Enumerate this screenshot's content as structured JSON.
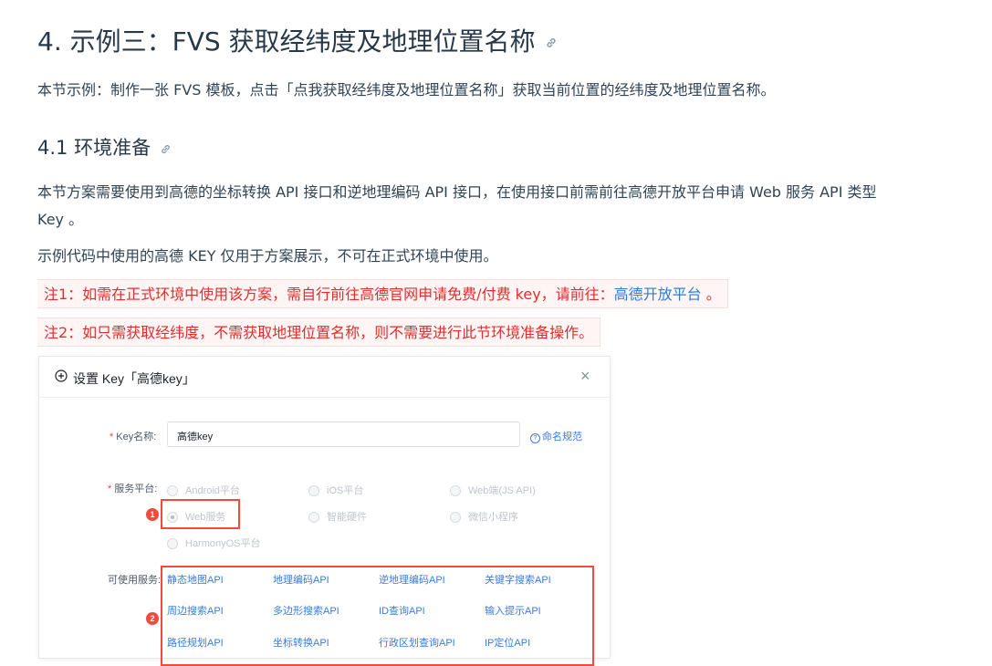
{
  "section": {
    "title": "4. 示例三：FVS 获取经纬度及地理位置名称",
    "intro": "本节示例：制作一张 FVS 模板，点击「点我获取经纬度及地理位置名称」获取当前位置的经纬度及地理位置名称。"
  },
  "subsection": {
    "title": "4.1 环境准备",
    "para1_line1": "本节方案需要使用到高德的坐标转换 API 接口和逆地理编码 API 接口，在使用接口前需前往高德开放平台申请 Web 服务 API 类型",
    "para1_line2": "Key 。",
    "para2": "示例代码中使用的高德 KEY 仅用于方案展示，不可在正式环境中使用。",
    "note1_text": "注1：如需在正式环境中使用该方案，需自行前往高德官网申请免费/付费 key，请前往：",
    "note1_link": "高德开放平台",
    "note1_end": " 。",
    "note2_text": "注2：如只需获取经纬度，不需获取地理位置名称，则不需要进行此节环境准备操作。"
  },
  "dialog": {
    "title": "设置 Key「高德key」",
    "close": "×",
    "key_name_label": "Key名称:",
    "key_name_value": "高德key",
    "naming_rule": "命名规范",
    "platform_label": "服务平台:",
    "platforms": [
      "Android平台",
      "iOS平台",
      "Web端(JS API)",
      "Web服务",
      "智能硬件",
      "微信小程序",
      "HarmonyOS平台"
    ],
    "selected_platform": "Web服务",
    "apis_label": "可使用服务:",
    "apis": [
      "静态地图API",
      "地理编码API",
      "逆地理编码API",
      "关键字搜索API",
      "周边搜索API",
      "多边形搜索API",
      "ID查询API",
      "输入提示API",
      "路径规划API",
      "坐标转换API",
      "行政区划查询API",
      "IP定位API"
    ],
    "badge1": "1",
    "badge2": "2"
  },
  "colors": {
    "link": "#2f7bd9",
    "note_text": "#e02d2d",
    "highlight": "#f24a3c"
  }
}
